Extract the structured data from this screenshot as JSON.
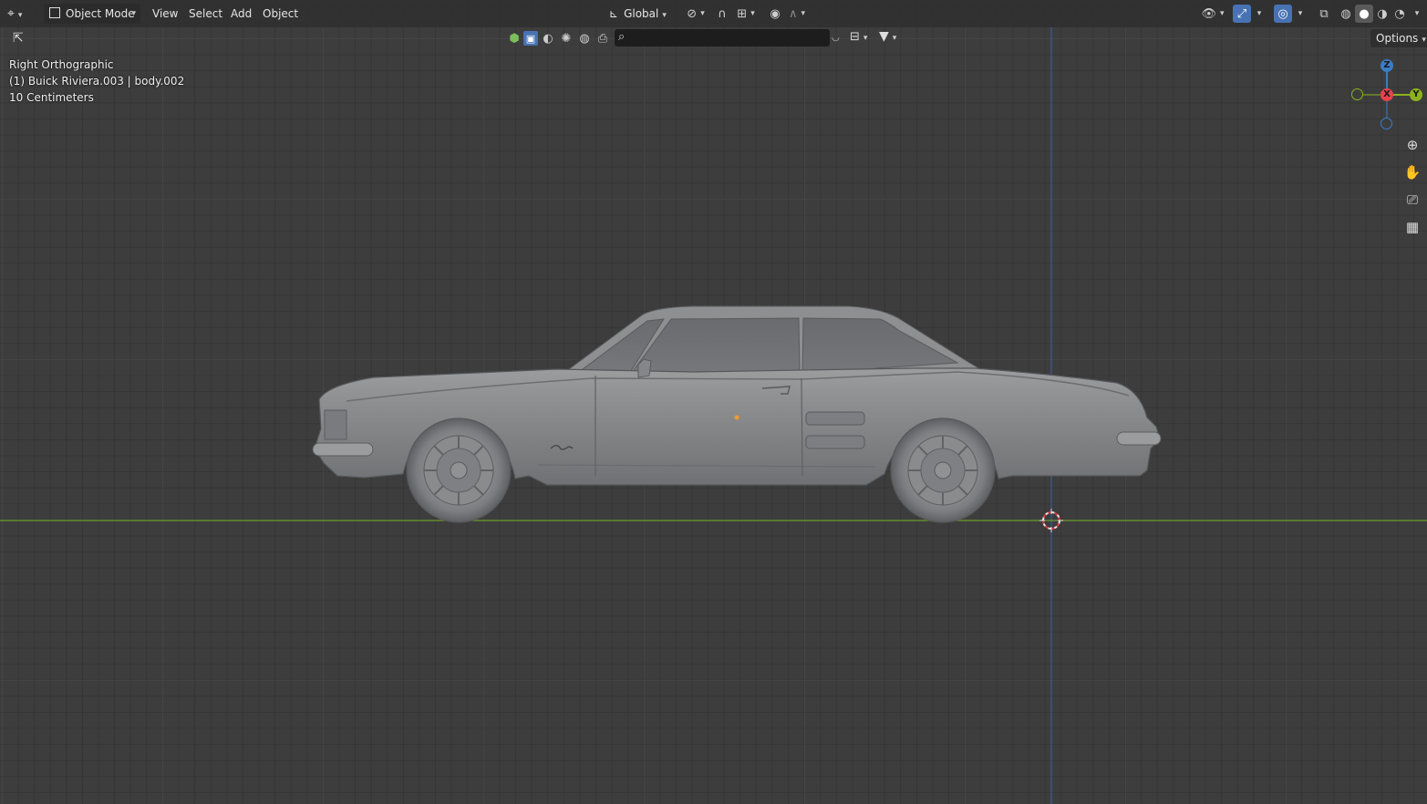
{
  "header": {
    "editor_type_icon": "3d-viewport-icon",
    "mode": {
      "label": "Object Mode",
      "icon": "object-mode-icon"
    },
    "menus": [
      "View",
      "Select",
      "Add",
      "Object"
    ],
    "transform_orientation": {
      "label": "Global",
      "icon": "axis-orientation-icon"
    },
    "pivot_icon": "pivot-point-icon",
    "snap_icon": "magnet-icon",
    "snap_target_icon": "snap-increment-icon",
    "proportional_icon": "proportional-edit-icon",
    "falloff_icon": "falloff-curve-icon",
    "right": {
      "visibility_icon": "eye-icon",
      "gizmo_icon": "gizmo-icon",
      "overlay_icon": "overlay-icon",
      "xray_icon": "xray-icon",
      "shading_icons": [
        "wireframe-shading-icon",
        "solid-shading-icon",
        "material-shading-icon",
        "rendered-shading-icon"
      ]
    }
  },
  "toolbar2": {
    "tool_icon": "select-cursor-icon",
    "filter_icons": [
      "object-type-icon",
      "select-box-icon",
      "material-preview-icon",
      "light-icon",
      "world-icon",
      "camera-filter-icon"
    ],
    "search_placeholder": "",
    "options_label": "Options"
  },
  "viewport_info": {
    "view_name": "Right Orthographic",
    "object_line": "(1) Buick Riviera.003 | body.002",
    "grid_scale": "10 Centimeters"
  },
  "gizmo": {
    "z_label": "Z",
    "x_label": "X",
    "y_label": "Y",
    "colors": {
      "x": "#e8424d",
      "y": "#8bb21d",
      "z": "#3b7cc6"
    }
  },
  "nav_buttons": [
    "zoom-icon",
    "hand-pan-icon",
    "camera-view-icon",
    "grid-toggle-icon"
  ],
  "colors": {
    "background": "#3d3d3d",
    "header": "#303030",
    "accent": "#4772b3",
    "ground_line": "#6a9a28",
    "z_axis_line": "#3a5a9e",
    "car_body": "#8a8b8d"
  }
}
